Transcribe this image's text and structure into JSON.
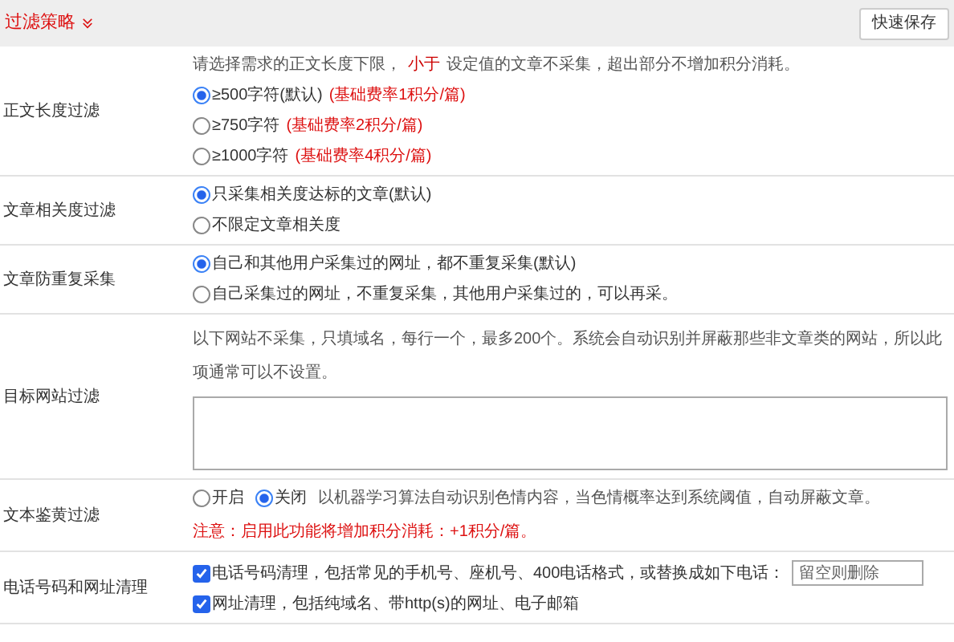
{
  "header": {
    "title": "过滤策略",
    "save_button": "快速保存"
  },
  "rows": [
    {
      "kind": "radio",
      "label": "正文长度过滤",
      "note": "请选择需求的正文长度下限，**小于**设定值的文章不采集，超出部分不增加积分消耗。",
      "options": [
        {
          "label": "≥500字符(默认)",
          "extra": "(基础费率1积分/篇)",
          "selected": true
        },
        {
          "label": "≥750字符",
          "extra": "(基础费率2积分/篇)",
          "selected": false
        },
        {
          "label": "≥1000字符",
          "extra": "(基础费率4积分/篇)",
          "selected": false
        }
      ]
    },
    {
      "kind": "radio",
      "label": "文章相关度过滤",
      "options": [
        {
          "label": "只采集相关度达标的文章(默认)",
          "selected": true
        },
        {
          "label": "不限定文章相关度",
          "selected": false
        }
      ]
    },
    {
      "kind": "radio",
      "label": "文章防重复采集",
      "options": [
        {
          "label": "自己和其他用户采集过的网址，都不重复采集(默认)",
          "selected": true
        },
        {
          "label": "自己采集过的网址，不重复采集，其他用户采集过的，可以再采。",
          "selected": false
        }
      ]
    },
    {
      "kind": "textarea",
      "label": "目标网站过滤",
      "note": "以下网站不采集，只填域名，每行一个，最多200个。系统会自动识别并屏蔽那些非文章类的网站，所以此项通常可以不设置。"
    },
    {
      "kind": "inline_radio",
      "label": "文本鉴黄过滤",
      "options": [
        {
          "label": "开启",
          "selected": false
        },
        {
          "label": "关闭",
          "selected": true
        }
      ],
      "description": "以机器学习算法自动识别色情内容，当色情概率达到系统阈值，自动屏蔽文章。",
      "warning": "注意：启用此功能将增加积分消耗：+1积分/篇。"
    },
    {
      "kind": "checkbox",
      "label": "电话号码和网址清理",
      "options": [
        {
          "label": "电话号码清理，包括常见的手机号、座机号、400电话格式，或替换成如下电话：",
          "checked": true,
          "placeholder": "留空则删除"
        },
        {
          "label": "网址清理，包括纯域名、带http(s)的网址、电子邮箱",
          "checked": true
        }
      ]
    }
  ]
}
